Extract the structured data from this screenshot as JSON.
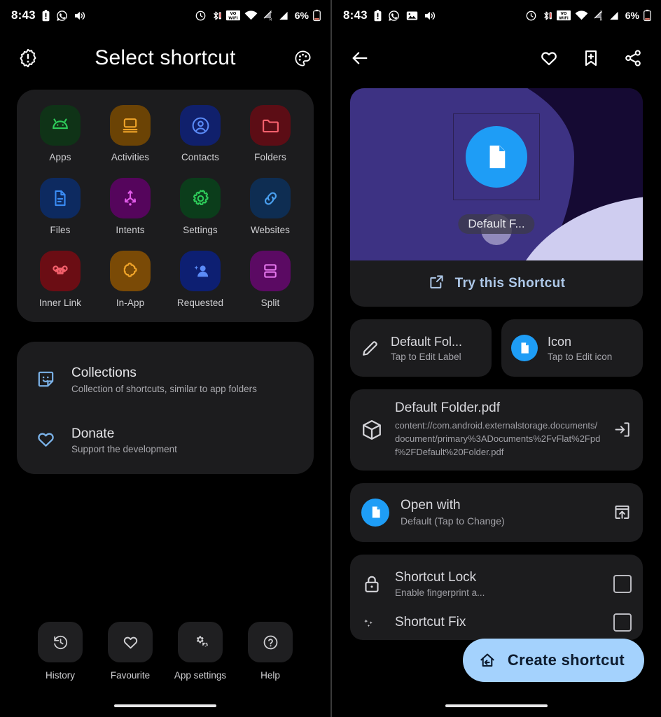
{
  "left": {
    "statusbar": {
      "time": "8:43",
      "battery_pct": "6%",
      "left_icons": [
        "battery-alert-icon",
        "whatsapp-icon",
        "volume-icon"
      ],
      "right_icons": [
        "alarm-icon",
        "bluetooth-icon",
        "volte-wifi-icon",
        "wifi-icon",
        "sim1-signal-icon",
        "sim2-signal-icon"
      ]
    },
    "appbar": {
      "title": "Select shortcut",
      "left_icon": "new-releases-icon",
      "right_icon": "palette-icon"
    },
    "grid": [
      {
        "label": "Apps",
        "icon": "android-icon",
        "tile": "#0f3317",
        "fg": "#2ecc5a"
      },
      {
        "label": "Activities",
        "icon": "window-icon",
        "tile": "#6b4305",
        "fg": "#f0a429"
      },
      {
        "label": "Contacts",
        "icon": "account-icon",
        "tile": "#10206c",
        "fg": "#5b8bf7"
      },
      {
        "label": "Folders",
        "icon": "folder-icon",
        "tile": "#5c0d15",
        "fg": "#f4606c"
      },
      {
        "label": "Files",
        "icon": "file-icon",
        "tile": "#0d2a60",
        "fg": "#3a8cf5"
      },
      {
        "label": "Intents",
        "icon": "intents-icon",
        "tile": "#55055c",
        "fg": "#e05ae8"
      },
      {
        "label": "Settings",
        "icon": "gear-icon",
        "tile": "#0b3d1b",
        "fg": "#2ecc5a"
      },
      {
        "label": "Websites",
        "icon": "link-icon",
        "tile": "#0e2d52",
        "fg": "#4aa0f0"
      },
      {
        "label": "Inner Link",
        "icon": "command-icon",
        "tile": "#6b0d14",
        "fg": "#f4606c"
      },
      {
        "label": "In-App",
        "icon": "puzzle-icon",
        "tile": "#7a4a06",
        "fg": "#f0a429"
      },
      {
        "label": "Requested",
        "icon": "person-add-icon",
        "tile": "#0d1f72",
        "fg": "#5b8bf7"
      },
      {
        "label": "Split",
        "icon": "split-icon",
        "tile": "#5b0a63",
        "fg": "#e878f0"
      }
    ],
    "list": [
      {
        "title": "Collections",
        "subtitle": "Collection of shortcuts, similar to app folders",
        "icon": "sticker-icon"
      },
      {
        "title": "Donate",
        "subtitle": "Support the development",
        "icon": "heart-icon"
      }
    ],
    "bottomnav": [
      {
        "label": "History",
        "icon": "history-icon"
      },
      {
        "label": "Favourite",
        "icon": "heart-icon"
      },
      {
        "label": "App settings",
        "icon": "settings-gear-icon"
      },
      {
        "label": "Help",
        "icon": "help-circle-icon"
      }
    ]
  },
  "right": {
    "statusbar": {
      "time": "8:43",
      "battery_pct": "6%",
      "left_icons": [
        "battery-alert-icon",
        "whatsapp-icon",
        "image-icon",
        "volume-icon"
      ],
      "right_icons": [
        "alarm-icon",
        "bluetooth-icon",
        "volte-wifi-icon",
        "wifi-icon",
        "sim1-signal-icon",
        "sim2-signal-icon"
      ]
    },
    "appbar": {
      "back_icon": "back-arrow-icon",
      "favourite_icon": "heart-icon",
      "bookmark_icon": "bookmark-add-icon",
      "share_icon": "share-icon"
    },
    "preview": {
      "label": "Default F...",
      "try_label": "Try this Shortcut",
      "try_icon": "open-in-new-icon",
      "shortcut_icon": "file-document-icon",
      "accent": "#1e9df6",
      "wallpaper_purple": "#3d3283",
      "wallpaper_dark": "#150a33",
      "wallpaper_light": "#cfcdf0"
    },
    "label_card": {
      "title": "Default Fol...",
      "subtitle": "Tap to Edit Label",
      "icon": "pencil-icon"
    },
    "icon_card": {
      "title": "Icon",
      "subtitle": "Tap to Edit icon",
      "icon": "file-document-icon"
    },
    "uri_card": {
      "title": "Default Folder.pdf",
      "uri": "content://com.android.externalstorage.documents/document/primary%3ADocuments%2FvFlat%2Fpdf%2FDefault%20Folder.pdf",
      "icon": "package-icon",
      "action_icon": "input-arrow-icon"
    },
    "open_with": {
      "title": "Open with",
      "subtitle": "Default (Tap to Change)",
      "icon": "file-document-icon",
      "action_icon": "open-in-browser-icon"
    },
    "lock_rows": [
      {
        "title": "Shortcut Lock",
        "subtitle": "Enable fingerprint a...",
        "icon": "lock-icon"
      },
      {
        "title": "Shortcut Fix",
        "subtitle": "",
        "icon": "magic-fix-icon"
      }
    ],
    "fab": {
      "label": "Create shortcut",
      "icon": "add-to-home-screen-icon",
      "color": "#a4d2fd",
      "text_color": "#0d1b2e"
    }
  }
}
